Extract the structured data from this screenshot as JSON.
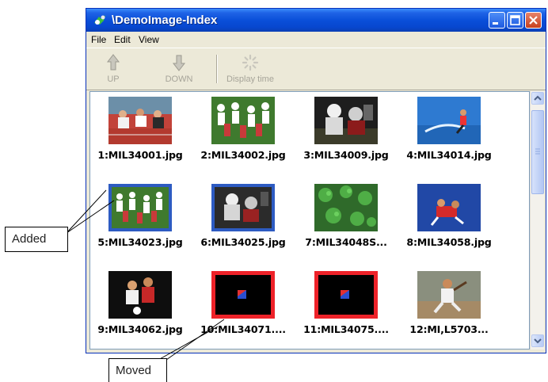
{
  "window": {
    "title": "\\DemoImage-Index",
    "menu": [
      "File",
      "Edit",
      "View"
    ],
    "toolbar": [
      {
        "label": "UP",
        "icon": "arrow-up-icon"
      },
      {
        "label": "DOWN",
        "icon": "arrow-down-icon"
      },
      {
        "label": "Display time",
        "icon": "clock-spinner-icon"
      }
    ]
  },
  "images": [
    {
      "label": "1:MIL34001.jpg",
      "selection": "none"
    },
    {
      "label": "2:MIL34002.jpg",
      "selection": "none"
    },
    {
      "label": "3:MIL34009.jpg",
      "selection": "none"
    },
    {
      "label": "4:MIL34014.jpg",
      "selection": "none"
    },
    {
      "label": "5:MIL34023.jpg",
      "selection": "blue"
    },
    {
      "label": "6:MIL34025.jpg",
      "selection": "blue"
    },
    {
      "label": "7:MIL34048S...",
      "selection": "none"
    },
    {
      "label": "8:MIL34058.jpg",
      "selection": "none"
    },
    {
      "label": "9:MIL34062.jpg",
      "selection": "none"
    },
    {
      "label": "10:MIL34071....",
      "selection": "red"
    },
    {
      "label": "11:MIL34075....",
      "selection": "red"
    },
    {
      "label": "12:MI,L5703...",
      "selection": "none"
    }
  ],
  "callouts": {
    "added": "Added",
    "moved": "Moved"
  },
  "colors": {
    "selection_blue": "#2d5bc2",
    "selection_red": "#ee2229",
    "titlebar": "#0a4fd9"
  }
}
